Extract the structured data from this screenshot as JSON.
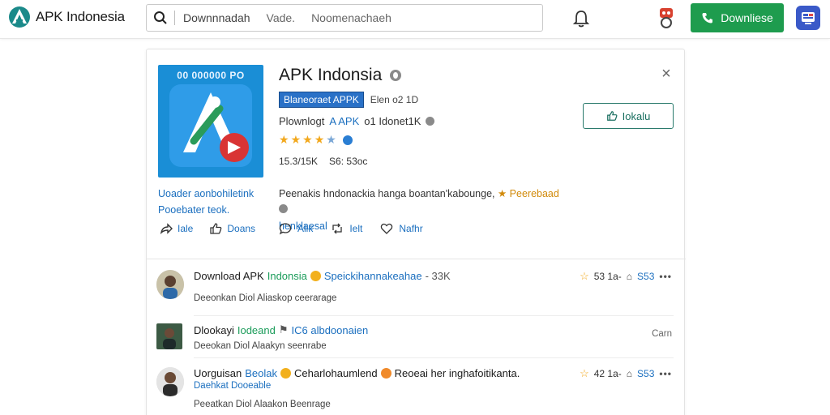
{
  "header": {
    "brand": "APK Indonesia",
    "search_segments": [
      "Downnnadah",
      "Vade.",
      "Noomenachaeh"
    ],
    "download_label": "Downliese",
    "accent_green": "#1e9c4e",
    "icons": [
      "logo-icon",
      "search-icon",
      "bell-icon",
      "mascot-icon",
      "phone-icon",
      "app-grid-icon"
    ]
  },
  "app": {
    "tile_code": "00 000000 PO",
    "title": "APK Indonsia",
    "tag": "Blaneoraet APPK",
    "tag_aside": "Elen o2 1D",
    "download_line_prefix": "Plownlogt",
    "download_line_highlight": "A APK",
    "download_line_suffix": "o1 Idonet1K",
    "rating_stars": 4.5,
    "stats": [
      "15.3/15K",
      "S6: 53oc"
    ],
    "desc_text": "Peenakis hndonackia hanga boantan'kabounge,",
    "desc_gold": "Peerebaad",
    "desc_blue": "henklaesal",
    "install_label": "Iokalu",
    "caption": "Uoader aonbohiletink Pooebater teok."
  },
  "tile_actions": [
    {
      "icon": "share-icon",
      "label": "Iale"
    },
    {
      "icon": "thumbs-up-icon",
      "label": "Doans"
    }
  ],
  "app_actions": [
    {
      "icon": "comment-icon",
      "label": "Alik"
    },
    {
      "icon": "retweet-icon",
      "label": "Ielt"
    },
    {
      "icon": "heart-icon",
      "label": "Nafhr"
    }
  ],
  "comments": [
    {
      "name": "Download APK",
      "name_green": "Indonsia",
      "extra": "Speickihannakeahae",
      "count": "- 33K",
      "sub": "Deeonkan Diol Aliaskop ceerarage",
      "right_num1": "53 1a-",
      "right_num2": "S53"
    },
    {
      "name": "Dlookayi",
      "name_green": "Iodeand",
      "extra": "IC6 albdoonaien",
      "count": "",
      "sub": "Deeokan Diol Alaakyn seenrabe",
      "right_text": "Carn"
    },
    {
      "name": "Uorguisan",
      "name_green": "Beolak",
      "extra": "Ceharlohaumlend",
      "extra2": "Reoeai her inghafoitikanta.",
      "name_line2": "Daehkat Dooeable",
      "count": "",
      "sub": "Peeatkan Diol Alaakon Beenrage",
      "right_num1": "42 1a-",
      "right_num2": "S53"
    }
  ]
}
